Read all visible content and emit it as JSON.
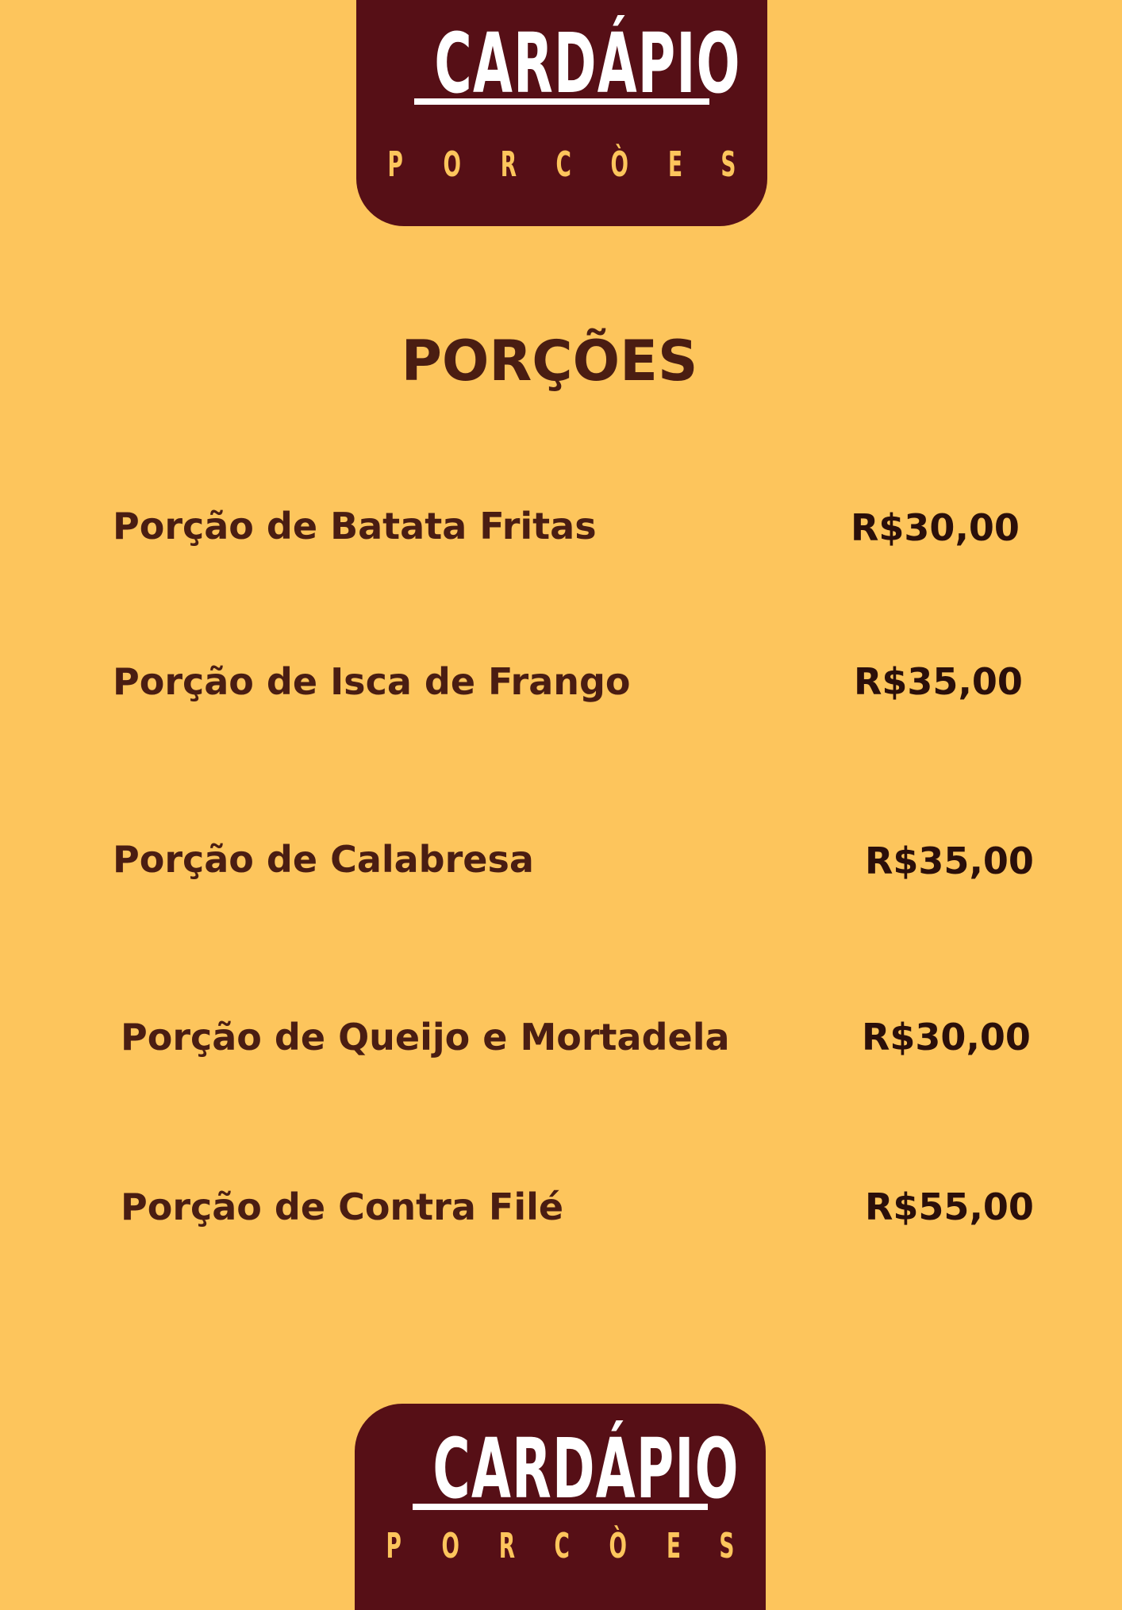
{
  "header_logo": {
    "word": "CARDÁPIO",
    "subtitle_letters": [
      "P",
      "O",
      "R",
      "C",
      "Ò",
      "E",
      "S"
    ]
  },
  "section_title": "PORÇÕES",
  "menu": {
    "items": [
      {
        "name": "Porção de Batata Fritas",
        "price": "R$30,00"
      },
      {
        "name": "Porção de Isca de Frango",
        "price": "R$35,00"
      },
      {
        "name": "Porção de Calabresa",
        "price": "R$35,00"
      },
      {
        "name": "Porção de Queijo e Mortadela",
        "price": "R$30,00"
      },
      {
        "name": "Porção de Contra Filé",
        "price": "R$55,00"
      }
    ]
  },
  "footer_logo": {
    "word": "CARDÁPIO",
    "subtitle_letters": [
      "P",
      "O",
      "R",
      "C",
      "Ò",
      "E",
      "S"
    ]
  },
  "colors": {
    "background": "#FDC55C",
    "badge": "#560F16",
    "text": "#4A1D12",
    "logo_word": "#FFFFFF"
  }
}
